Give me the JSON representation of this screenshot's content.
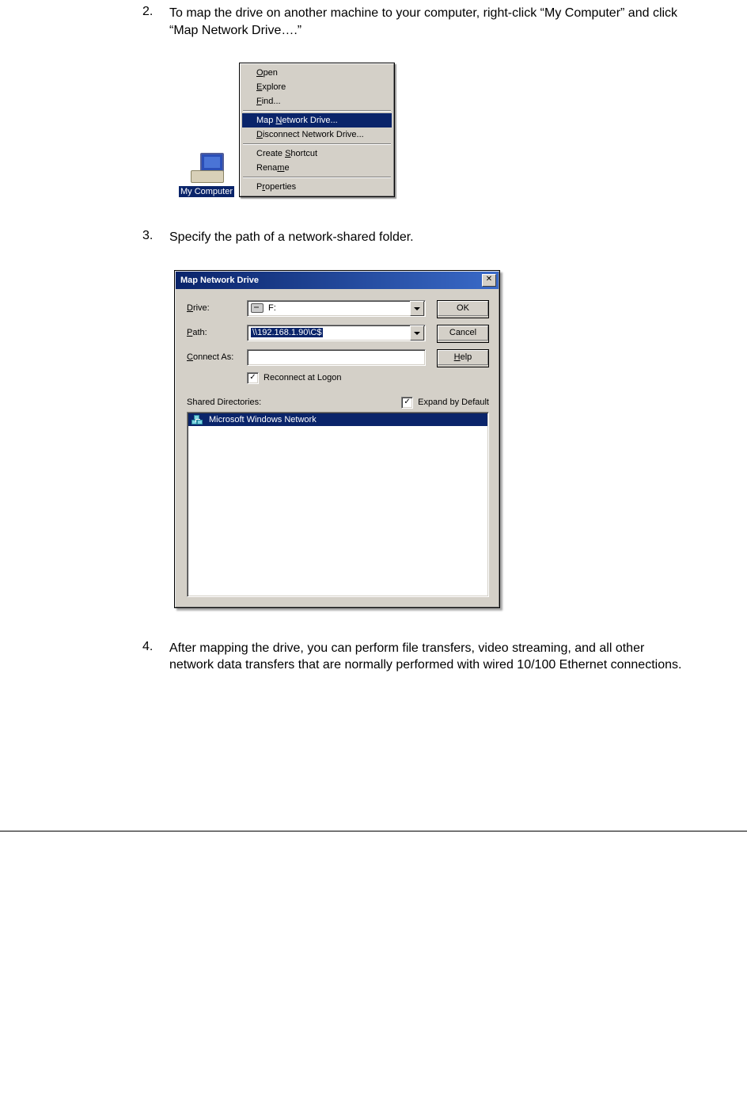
{
  "steps": {
    "s2": {
      "num": "2.",
      "text": "To map the drive on another machine to your computer, right-click “My Computer” and click “Map Network Drive….”"
    },
    "s3": {
      "num": "3.",
      "text": "Specify the path of a network-shared folder."
    },
    "s4": {
      "num": "4.",
      "text": "After mapping the drive, you can perform file transfers, video streaming, and all other network data transfers that are normally performed with wired 10/100 Ethernet connections."
    }
  },
  "desktop": {
    "icon_label": "My Computer"
  },
  "context_menu": {
    "items": [
      {
        "pre": "",
        "u": "O",
        "post": "pen"
      },
      {
        "pre": "",
        "u": "E",
        "post": "xplore"
      },
      {
        "pre": "",
        "u": "F",
        "post": "ind..."
      }
    ],
    "sel": {
      "pre": "Map ",
      "u": "N",
      "post": "etwork Drive..."
    },
    "item_disconnect": {
      "pre": "",
      "u": "D",
      "post": "isconnect Network Drive..."
    },
    "items2": [
      {
        "pre": "Create ",
        "u": "S",
        "post": "hortcut"
      },
      {
        "pre": "Rena",
        "u": "m",
        "post": "e"
      }
    ],
    "item_props": {
      "pre": "P",
      "u": "r",
      "post": "operties"
    }
  },
  "dialog": {
    "title": "Map Network Drive",
    "labels": {
      "drive": {
        "u": "D",
        "rest": "rive:"
      },
      "path": {
        "u": "P",
        "rest": "ath:"
      },
      "connect": {
        "u": "C",
        "rest": "onnect As:"
      },
      "reconnect": {
        "u": "R",
        "rest": "econnect at Logon"
      },
      "shared": {
        "u": "S",
        "rest": "hared Directories:"
      },
      "expand": {
        "u": "E",
        "rest": "xpand by Default"
      }
    },
    "drive_value": "F:",
    "path_value": "\\\\192.168.1.90\\C$",
    "connect_value": "",
    "reconnect_checked": true,
    "expand_checked": true,
    "buttons": {
      "ok": "OK",
      "cancel": "Cancel",
      "help": {
        "u": "H",
        "rest": "elp"
      }
    },
    "network_root": "Microsoft Windows Network"
  }
}
